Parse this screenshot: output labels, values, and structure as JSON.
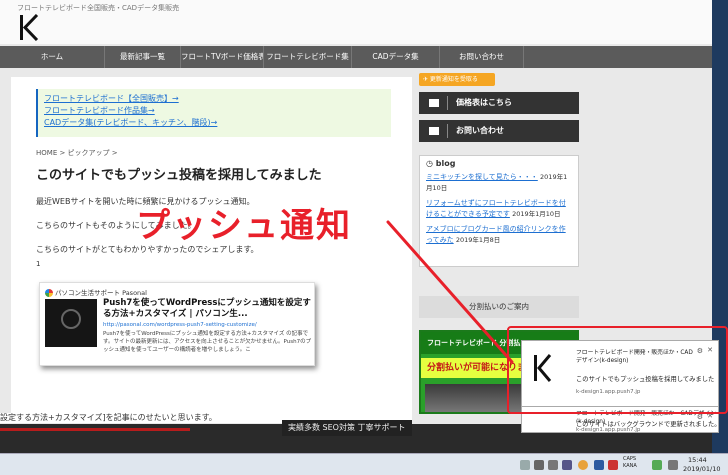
{
  "header": {
    "tagline": "フロートテレビボード全国販売・CADデータ集販売",
    "logo_alt": "K"
  },
  "nav": [
    {
      "label": "ホーム"
    },
    {
      "label": "最新記事一覧"
    },
    {
      "label": "フロートTVボード価格表"
    },
    {
      "label": "フロートテレビボード集"
    },
    {
      "label": "CADデータ集"
    },
    {
      "label": "お問い合わせ"
    }
  ],
  "main": {
    "links": [
      "フロートテレビボード【全国販売】→",
      "フロートテレビボード作品集→",
      "CADデータ集(テレビボード、キッチン、階段)→"
    ],
    "breadcrumb": "HOME > ピックアップ >",
    "title": "このサイトでもプッシュ投稿を採用してみました",
    "paragraphs": [
      "最近WEBサイトを開いた時に頻繁に見かけるプッシュ通知。",
      "こちらのサイトもそのようにしてみました。",
      "こちらのサイトがとてもわかりやすかったのでシェアします。"
    ],
    "index_mark": "1",
    "embed": {
      "source": "パソコン生活サポート Pasonal",
      "title": "Push7を使ってWordPressにプッシュ通知を設定する方法+カスタマイズ | パソコン生...",
      "url": "http://pasonal.com/wordpress-push7-setting-customize/",
      "description": "Push7を使ってWordPressにプッシュ通知を設定する方法+カスタマイズ の記事です。サイトの最新更新には、アクセスを向上させることが欠かせません。Push7のプッシュ通知を使ってユーザーの構読者を増やしましょう。こ"
    },
    "bottom_line": "設定する方法+カスタマイズ]を記事にのせたいと思います。"
  },
  "sidebar": {
    "notify_button": "✈ 更新通知を受取る",
    "price_button": "価格表はこちら",
    "contact_button": "お問い合わせ",
    "blog": {
      "title": "blog",
      "entries": [
        {
          "link": "ミニキッチンを探して見たら・・・",
          "date": "2019年1月10日"
        },
        {
          "link": "リフォームせずにフロートテレビボードを付けることができる予定です",
          "date": "2019年1月10日"
        },
        {
          "link": "アメブロにブログカード風の紹介リンクを作ってみた",
          "date": "2019年1月8日"
        }
      ]
    },
    "installment_head": "分割払いのご案内",
    "banner_top": "フロートテレビボード 分割払い",
    "banner_mid": "分割払いが可能になりました"
  },
  "annotation": {
    "text": "プッシュ通知",
    "color": "#e8202a"
  },
  "tags_strip": "実績多数  SEO対策  丁寧サポート",
  "notifications": [
    {
      "title": "フロートテレビボード開発・販売ほか・CADデザイン(k-design)",
      "body": "このサイトでもプッシュ投稿を採用してみました",
      "site": "k-design1.app.push7.jp"
    },
    {
      "title": "フロートテレビボード開発・販売ほか・CADデザイン(k-design)",
      "body": "このサイトはバックグラウンドで更新されました。",
      "site": "k-design1.app.push7.jp"
    }
  ],
  "taskbar": {
    "ime": "CAPS KANA",
    "time": "15:44",
    "date": "2019/01/10"
  }
}
